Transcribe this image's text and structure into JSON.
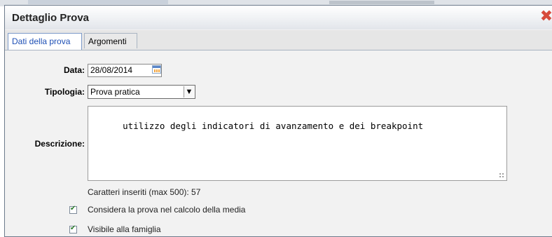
{
  "dialog": {
    "title": "Dettaglio Prova",
    "close_icon": "close-icon"
  },
  "tabs": [
    {
      "label": "Dati della prova",
      "active": true
    },
    {
      "label": "Argomenti",
      "active": false
    }
  ],
  "form": {
    "date_label": "Data:",
    "date_value": "28/08/2014",
    "type_label": "Tipologia:",
    "type_value": "Prova pratica",
    "description_label": "Descrizione:",
    "description_value": "utilizzo degli indicatori di avanzamento e dei breakpoint",
    "counter_text": "Caratteri inseriti (max 500): 57",
    "checkboxes": [
      {
        "label": "Considera la prova nel calcolo della media",
        "checked": true
      },
      {
        "label": "Visibile alla famiglia",
        "checked": true
      }
    ]
  },
  "colors": {
    "accent": "#1d4fb5",
    "close": "#d64a3a",
    "check": "#2a7a2a"
  }
}
